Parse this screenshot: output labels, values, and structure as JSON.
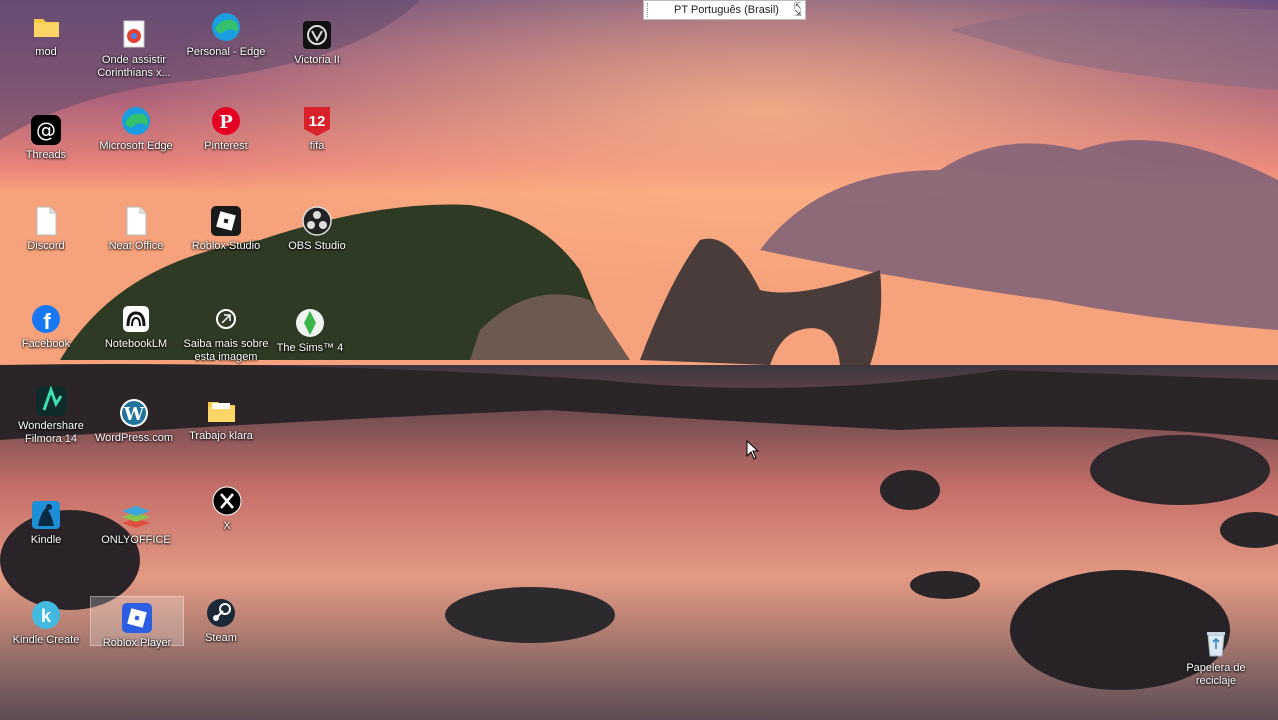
{
  "language_bar": {
    "text": "PT Português (Brasil)"
  },
  "desktop_icons": [
    {
      "label": "mod",
      "icon": "folder-icon"
    },
    {
      "label": "Onde assistir Corinthians x...",
      "icon": "chrome-shortcut-icon"
    },
    {
      "label": "Personal - Edge",
      "icon": "edge-icon"
    },
    {
      "label": "Victoria II",
      "icon": "victoria-icon"
    },
    {
      "label": "Threads",
      "icon": "threads-icon"
    },
    {
      "label": "Microsoft Edge",
      "icon": "edge-icon"
    },
    {
      "label": "Pinterest",
      "icon": "pinterest-icon"
    },
    {
      "label": "fifa",
      "icon": "fifa-icon"
    },
    {
      "label": "Discord",
      "icon": "file-icon"
    },
    {
      "label": "Neat Office",
      "icon": "file-icon"
    },
    {
      "label": "Roblox Studio",
      "icon": "roblox-studio-icon"
    },
    {
      "label": "OBS Studio",
      "icon": "obs-icon"
    },
    {
      "label": "Facebook",
      "icon": "facebook-icon"
    },
    {
      "label": "NotebookLM",
      "icon": "notebooklm-icon"
    },
    {
      "label": "Saiba mais sobre esta imagem",
      "icon": "spotlight-icon"
    },
    {
      "label": "The Sims™ 4",
      "icon": "sims-icon"
    },
    {
      "label": "Wondershare Filmora 14",
      "icon": "filmora-icon"
    },
    {
      "label": "WordPress.com",
      "icon": "wordpress-icon"
    },
    {
      "label": "Trabajo klara",
      "icon": "folder-icon"
    },
    {
      "label": "X",
      "icon": "x-icon"
    },
    {
      "label": "Kindle",
      "icon": "kindle-icon"
    },
    {
      "label": "ONLYOFFICE",
      "icon": "onlyoffice-icon"
    },
    {
      "label": "Kindle Create",
      "icon": "kindle-create-icon"
    },
    {
      "label": "Roblox Player",
      "icon": "roblox-player-icon"
    },
    {
      "label": "Steam",
      "icon": "steam-icon"
    },
    {
      "label": "Papelera de reciclaje",
      "icon": "recycle-bin-icon"
    }
  ]
}
